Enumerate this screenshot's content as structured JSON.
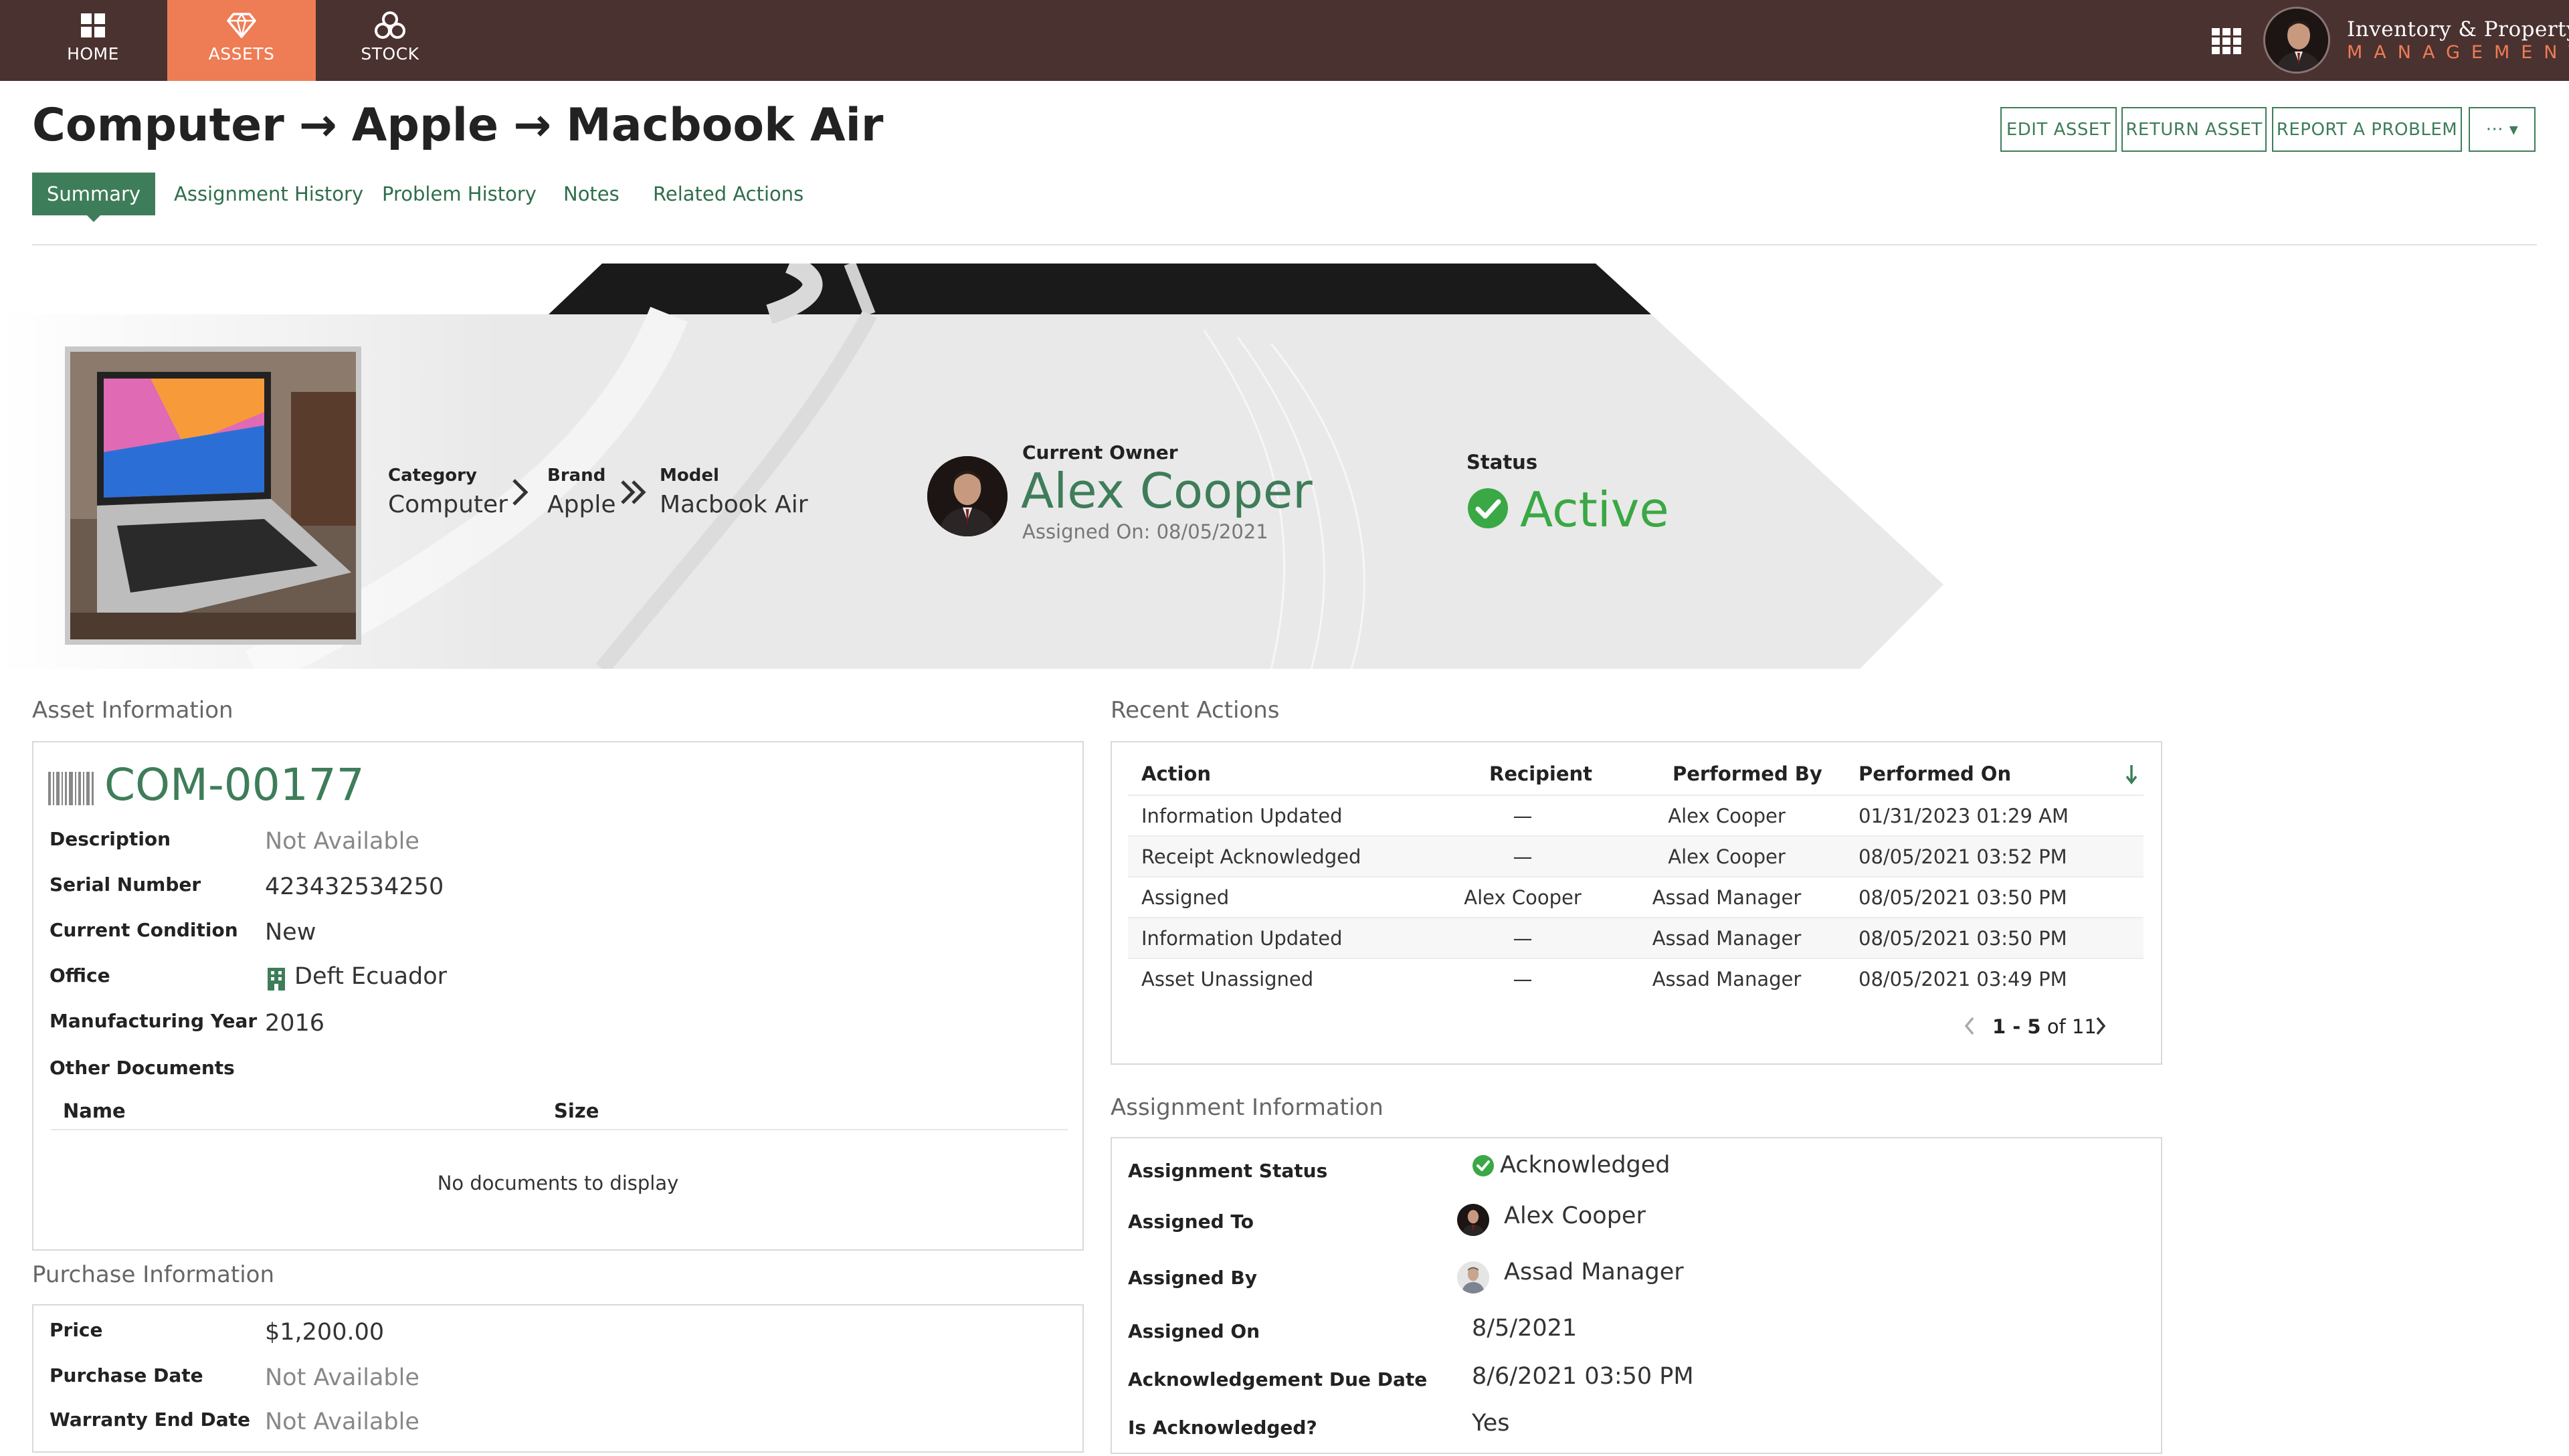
{
  "nav": {
    "items": [
      {
        "label": "HOME",
        "icon": "home-grid-icon"
      },
      {
        "label": "ASSETS",
        "icon": "diamond-icon",
        "active": true
      },
      {
        "label": "STOCK",
        "icon": "stock-boxes-icon"
      }
    ],
    "accent_color": "#ee7c55",
    "bar_color": "#4a3230"
  },
  "brand": {
    "line1": "Inventory & Property",
    "line2": "MANAGEMENT"
  },
  "page": {
    "title_parts": [
      "Computer",
      "Apple",
      "Macbook Air"
    ],
    "title_separator": "→"
  },
  "toolbar": {
    "edit_label": "EDIT ASSET",
    "return_label": "RETURN ASSET",
    "report_label": "REPORT A PROBLEM",
    "more_label": "··· ▾"
  },
  "tabs": [
    {
      "label": "Summary",
      "active": true
    },
    {
      "label": "Assignment History"
    },
    {
      "label": "Problem History"
    },
    {
      "label": "Notes"
    },
    {
      "label": "Related Actions"
    }
  ],
  "hero": {
    "category_label": "Category",
    "category_value": "Computer",
    "brand_label": "Brand",
    "brand_value": "Apple",
    "model_label": "Model",
    "model_value": "Macbook Air",
    "owner_label": "Current Owner",
    "owner_name": "Alex Cooper",
    "owner_assigned": "Assigned On: 08/05/2021",
    "status_label": "Status",
    "status_value": "Active",
    "status_color": "#3aa845"
  },
  "asset_info": {
    "section_title": "Asset Information",
    "code": "COM-00177",
    "fields": [
      {
        "label": "Description",
        "value": "Not Available"
      },
      {
        "label": "Serial Number",
        "value": "423432534250"
      },
      {
        "label": "Current Condition",
        "value": "New"
      },
      {
        "label": "Office",
        "value": "Deft Ecuador"
      },
      {
        "label": "Manufacturing Year",
        "value": "2016"
      }
    ],
    "documents_label": "Other Documents",
    "doc_col_name": "Name",
    "doc_col_size": "Size",
    "doc_empty": "No documents to display"
  },
  "purchase_info": {
    "section_title": "Purchase Information",
    "fields": [
      {
        "label": "Price",
        "value": "$1,200.00"
      },
      {
        "label": "Purchase Date",
        "value": "Not Available"
      },
      {
        "label": "Warranty End Date",
        "value": "Not Available"
      }
    ]
  },
  "recent_actions": {
    "section_title": "Recent Actions",
    "columns": [
      "Action",
      "Recipient",
      "Performed By",
      "Performed On"
    ],
    "rows": [
      [
        "Information Updated",
        "—",
        "Alex Cooper",
        "01/31/2023 01:29 AM"
      ],
      [
        "Receipt Acknowledged",
        "—",
        "Alex Cooper",
        "08/05/2021 03:52 PM"
      ],
      [
        "Assigned",
        "Alex Cooper",
        "Assad Manager",
        "08/05/2021 03:50 PM"
      ],
      [
        "Information Updated",
        "—",
        "Assad Manager",
        "08/05/2021 03:50 PM"
      ],
      [
        "Asset Unassigned",
        "—",
        "Assad Manager",
        "08/05/2021 03:49 PM"
      ]
    ],
    "pager_range": "1 - 5",
    "pager_total": "of 11"
  },
  "assignment_info": {
    "section_title": "Assignment Information",
    "fields": [
      {
        "label": "Assignment Status",
        "value": "Acknowledged"
      },
      {
        "label": "Assigned To",
        "value": "Alex Cooper"
      },
      {
        "label": "Assigned By",
        "value": "Assad Manager"
      },
      {
        "label": "Assigned On",
        "value": "8/5/2021"
      },
      {
        "label": "Acknowledgement Due Date",
        "value": "8/6/2021 03:50 PM"
      },
      {
        "label": "Is Acknowledged?",
        "value": "Yes"
      }
    ]
  }
}
